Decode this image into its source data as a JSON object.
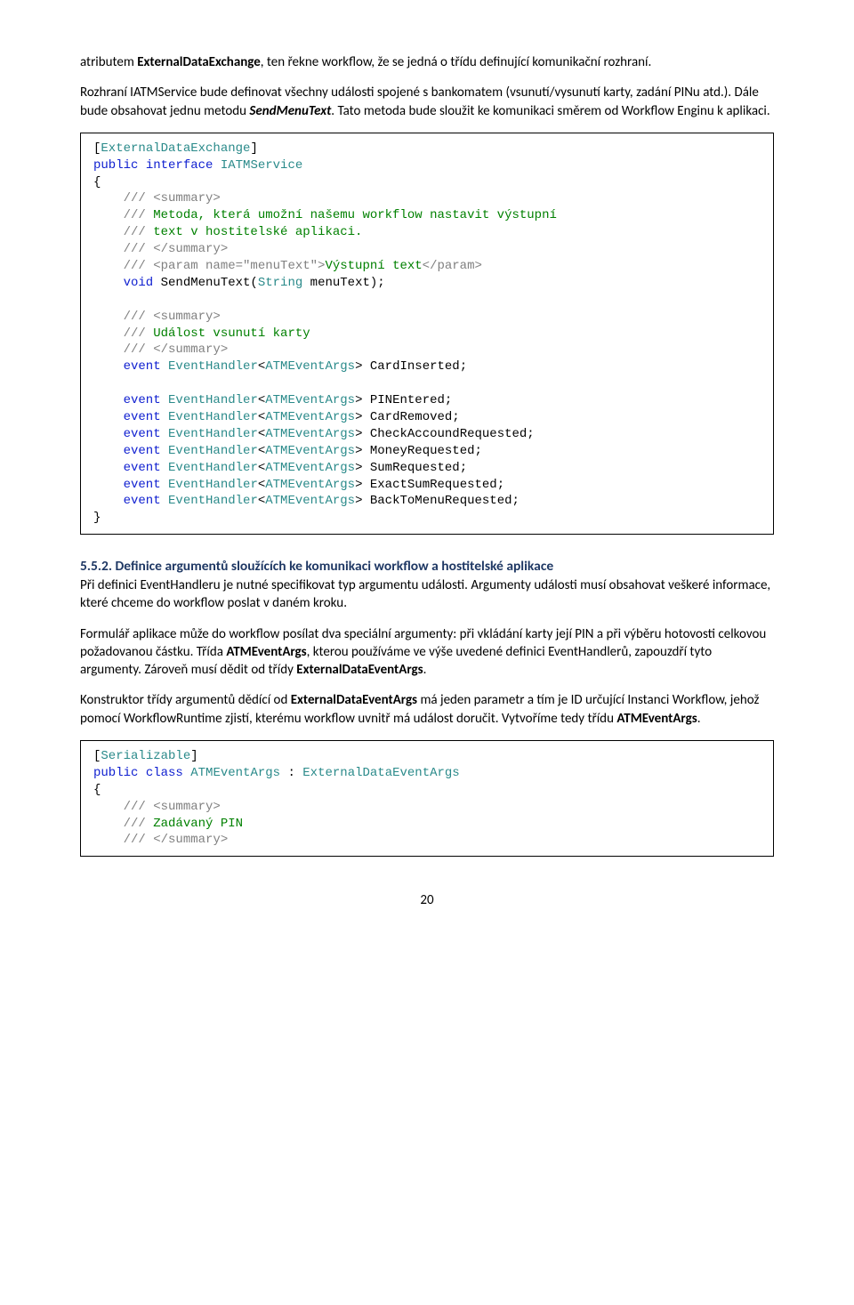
{
  "para1a": "atributem ",
  "para1b": "ExternalDataExchange",
  "para1c": ", ten řekne workflow, že se jedná o třídu definující komunikační rozhraní.",
  "para2a": "Rozhraní IATMService bude definovat všechny události spojené s bankomatem (vsunutí/vysunutí karty, zadání PINu atd.). Dále bude obsahovat jednu metodu ",
  "para2b": "SendMenuText",
  "para2c": ". Tato metoda bude sloužit ke komunikaci směrem od Workflow Enginu k aplikaci.",
  "code1": {
    "l1a": "[",
    "l1b": "ExternalDataExchange",
    "l1c": "]",
    "l2a": "public",
    "l2b": " interface",
    "l2c": " IATMService",
    "l3": "{",
    "l4a": "    ///",
    "l4b": " <summary>",
    "l5a": "    ///",
    "l5b": " Metoda, která umožní našemu workflow nastavit výstupní",
    "l6a": "    ///",
    "l6b": " text v hostitelské aplikaci.",
    "l7a": "    ///",
    "l7b": " </summary>",
    "l8a": "    ///",
    "l8b": " <param name=\"menuText\">",
    "l8c": "Výstupní text",
    "l8d": "</param>",
    "l9a": "    void",
    "l9b": " SendMenuText(",
    "l9c": "String",
    "l9d": " menuText);",
    "l10": "",
    "l11a": "    ///",
    "l11b": " <summary>",
    "l12a": "    ///",
    "l12b": " Událost vsunutí karty",
    "l13a": "    ///",
    "l13b": " </summary>",
    "l14a": "    event",
    "l14b": " EventHandler",
    "l14c": "<",
    "l14d": "ATMEventArgs",
    "l14e": "> CardInserted;",
    "l15": "",
    "l16a": "    event",
    "l16b": " EventHandler",
    "l16c": "<",
    "l16d": "ATMEventArgs",
    "l16e": "> PINEntered;",
    "l17a": "    event",
    "l17b": " EventHandler",
    "l17c": "<",
    "l17d": "ATMEventArgs",
    "l17e": "> CardRemoved;",
    "l18a": "    event",
    "l18b": " EventHandler",
    "l18c": "<",
    "l18d": "ATMEventArgs",
    "l18e": "> CheckAccoundRequested;",
    "l19a": "    event",
    "l19b": " EventHandler",
    "l19c": "<",
    "l19d": "ATMEventArgs",
    "l19e": "> MoneyRequested;",
    "l20a": "    event",
    "l20b": " EventHandler",
    "l20c": "<",
    "l20d": "ATMEventArgs",
    "l20e": "> SumRequested;",
    "l21a": "    event",
    "l21b": " EventHandler",
    "l21c": "<",
    "l21d": "ATMEventArgs",
    "l21e": "> ExactSumRequested;",
    "l22a": "    event",
    "l22b": " EventHandler",
    "l22c": "<",
    "l22d": "ATMEventArgs",
    "l22e": "> BackToMenuRequested;",
    "l23": "}"
  },
  "heading": "5.5.2.   Definice argumentů sloužících ke komunikaci workflow a hostitelské aplikace",
  "para3": "Při definici EventHandleru je nutné specifikovat typ argumentu události. Argumenty události musí obsahovat veškeré informace, které chceme do workflow poslat v daném kroku.",
  "para4a": "Formulář aplikace může do workflow posílat dva speciální argumenty: při vkládání karty její PIN a při výběru hotovosti celkovou požadovanou částku. Třída ",
  "para4b": "ATMEventArgs",
  "para4c": ", kterou používáme ve výše uvedené definici EventHandlerů, zapouzdří tyto argumenty. Zároveň musí dědit od třídy ",
  "para4d": "ExternalDataEventArgs",
  "para4e": ".",
  "para5a": "Konstruktor třídy argumentů dědící od ",
  "para5b": "ExternalDataEventArgs",
  "para5c": " má jeden parametr a tím je ID určující Instanci Workflow, jehož pomocí WorkflowRuntime zjistí, kterému workflow uvnitř má událost doručit. Vytvoříme tedy třídu ",
  "para5d": "ATMEventArgs",
  "para5e": ".",
  "code2": {
    "l1a": "[",
    "l1b": "Serializable",
    "l1c": "]",
    "l2a": "public",
    "l2b": " class",
    "l2c": " ATMEventArgs",
    "l2d": " : ",
    "l2e": "ExternalDataEventArgs",
    "l3": "{",
    "l4a": "    ///",
    "l4b": " <summary>",
    "l5a": "    ///",
    "l5b": " Zadávaný PIN",
    "l6a": "    ///",
    "l6b": " </summary>"
  },
  "pagenum": "20"
}
